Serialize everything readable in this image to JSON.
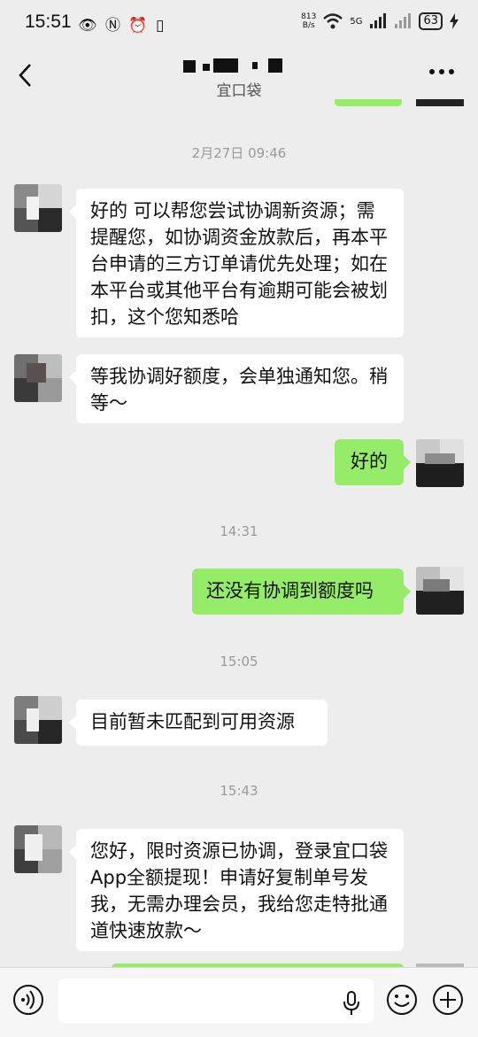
{
  "status": {
    "time": "15:51",
    "icons_left": "👁 Ⓝ ⏰ ▯",
    "speed": "813\nB/s",
    "network": "5G",
    "battery": "63"
  },
  "nav": {
    "title": "",
    "subtitle": "宜口袋"
  },
  "messages": {
    "ts1": "2月27日 09:46",
    "m1": "好的 可以帮您尝试协调新资源；需提醒您，如协调资金放款后，再本平台申请的三方订单请优先处理；如在本平台或其他平台有逾期可能会被划扣，这个您知悉哈",
    "m2": "等我协调好额度，会单独通知您。稍等～",
    "m3": "好的",
    "ts2": "14:31",
    "m4": "还没有协调到额度吗",
    "ts3": "15:05",
    "m5": "目前暂未匹配到可用资源",
    "ts4": "15:43",
    "m6": "您好，限时资源已协调，登录宜口袋App全额提现！申请好复制单号发我，无需办理会员，我给您走特批通道快速放款～"
  },
  "input": {
    "placeholder": ""
  },
  "colors": {
    "background": "#ededed",
    "outgoing_bubble": "#95ec69",
    "incoming_bubble": "#ffffff"
  }
}
